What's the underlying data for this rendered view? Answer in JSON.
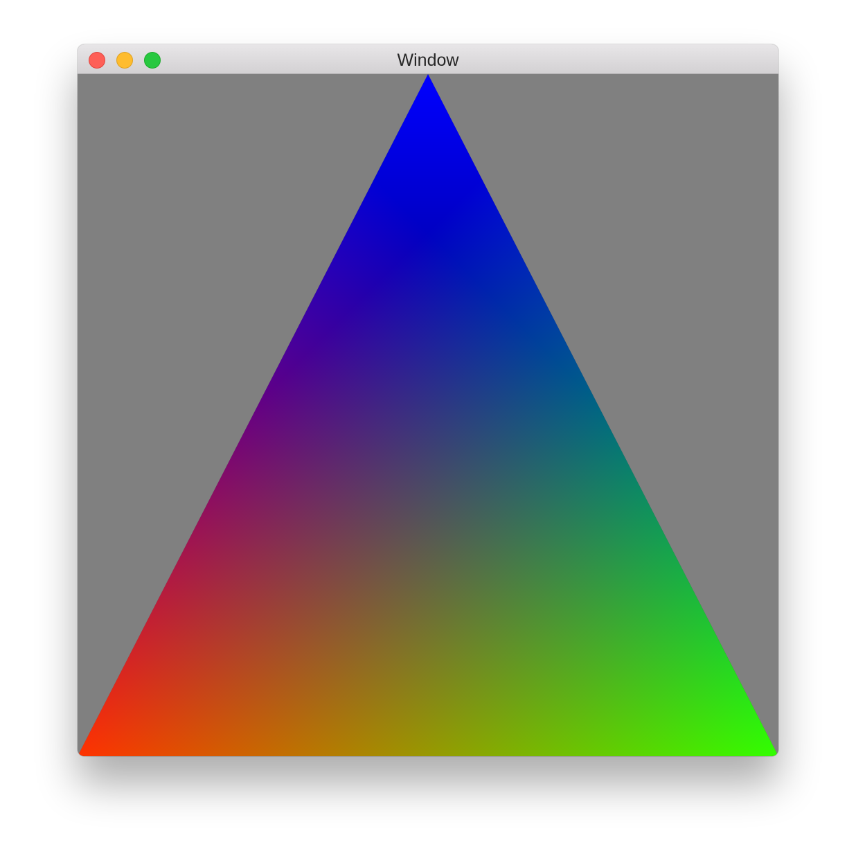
{
  "window": {
    "title": "Window"
  },
  "titlebar": {
    "buttons": [
      {
        "name": "close",
        "color": "#fe5f57"
      },
      {
        "name": "minimize",
        "color": "#febc2e"
      },
      {
        "name": "zoom",
        "color": "#28c840"
      }
    ]
  },
  "content": {
    "background_color": "#808080",
    "triangle": {
      "vertex_colors": {
        "top": "#0000ff",
        "bottom_left": "#ff0000",
        "bottom_right": "#00ff00"
      }
    }
  }
}
